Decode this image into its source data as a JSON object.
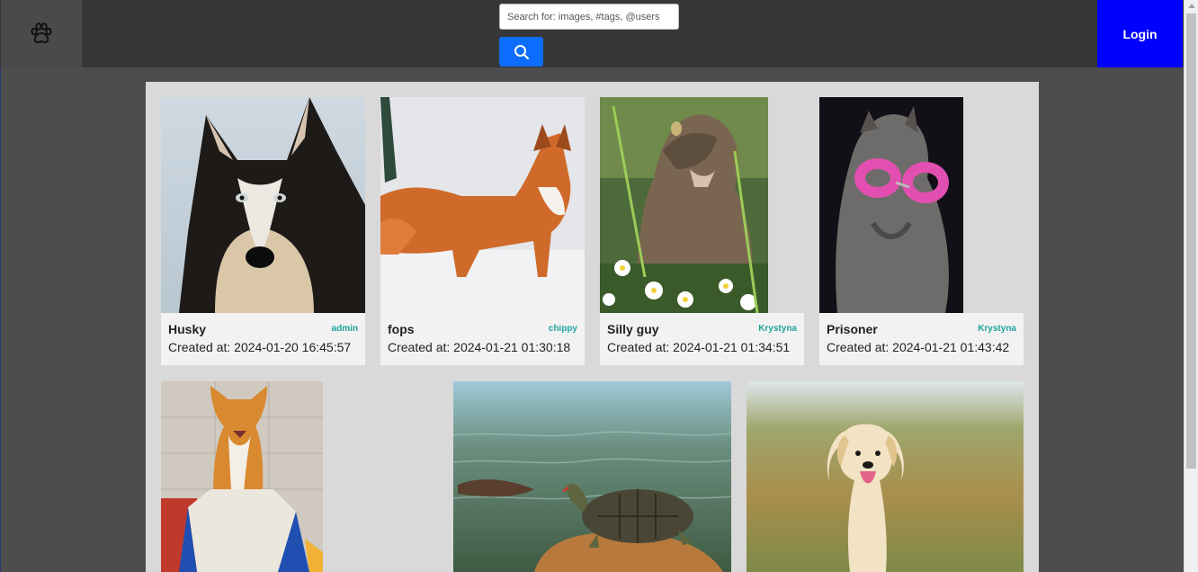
{
  "header": {
    "logo_icon": "paw-icon",
    "search": {
      "placeholder": "Search for: images, #tags, @users",
      "value": "",
      "button_icon": "search-icon"
    },
    "login_label": "Login",
    "colors": {
      "search_button": "#0d6efd",
      "login_button": "#0000ff"
    }
  },
  "posts": [
    {
      "title": "Husky",
      "author": "admin",
      "created": "Created at: 2024-01-20 16:45:57",
      "image": "husky-photo"
    },
    {
      "title": "fops",
      "author": "chippy",
      "created": "Created at: 2024-01-21 01:30:18",
      "image": "fox-photo"
    },
    {
      "title": "Silly guy",
      "author": "Krystyna",
      "created": "Created at: 2024-01-21 01:34:51",
      "image": "tabby-cat-photo"
    },
    {
      "title": "Prisoner",
      "author": "Krystyna",
      "created": "Created at: 2024-01-21 01:43:42",
      "image": "cat-with-handcuffs-photo"
    },
    {
      "image": "orange-cat-in-box-photo"
    },
    {
      "image": "turtle-photo"
    },
    {
      "image": "golden-puppy-photo"
    }
  ],
  "accent_colors": {
    "author": "#20a39e"
  }
}
